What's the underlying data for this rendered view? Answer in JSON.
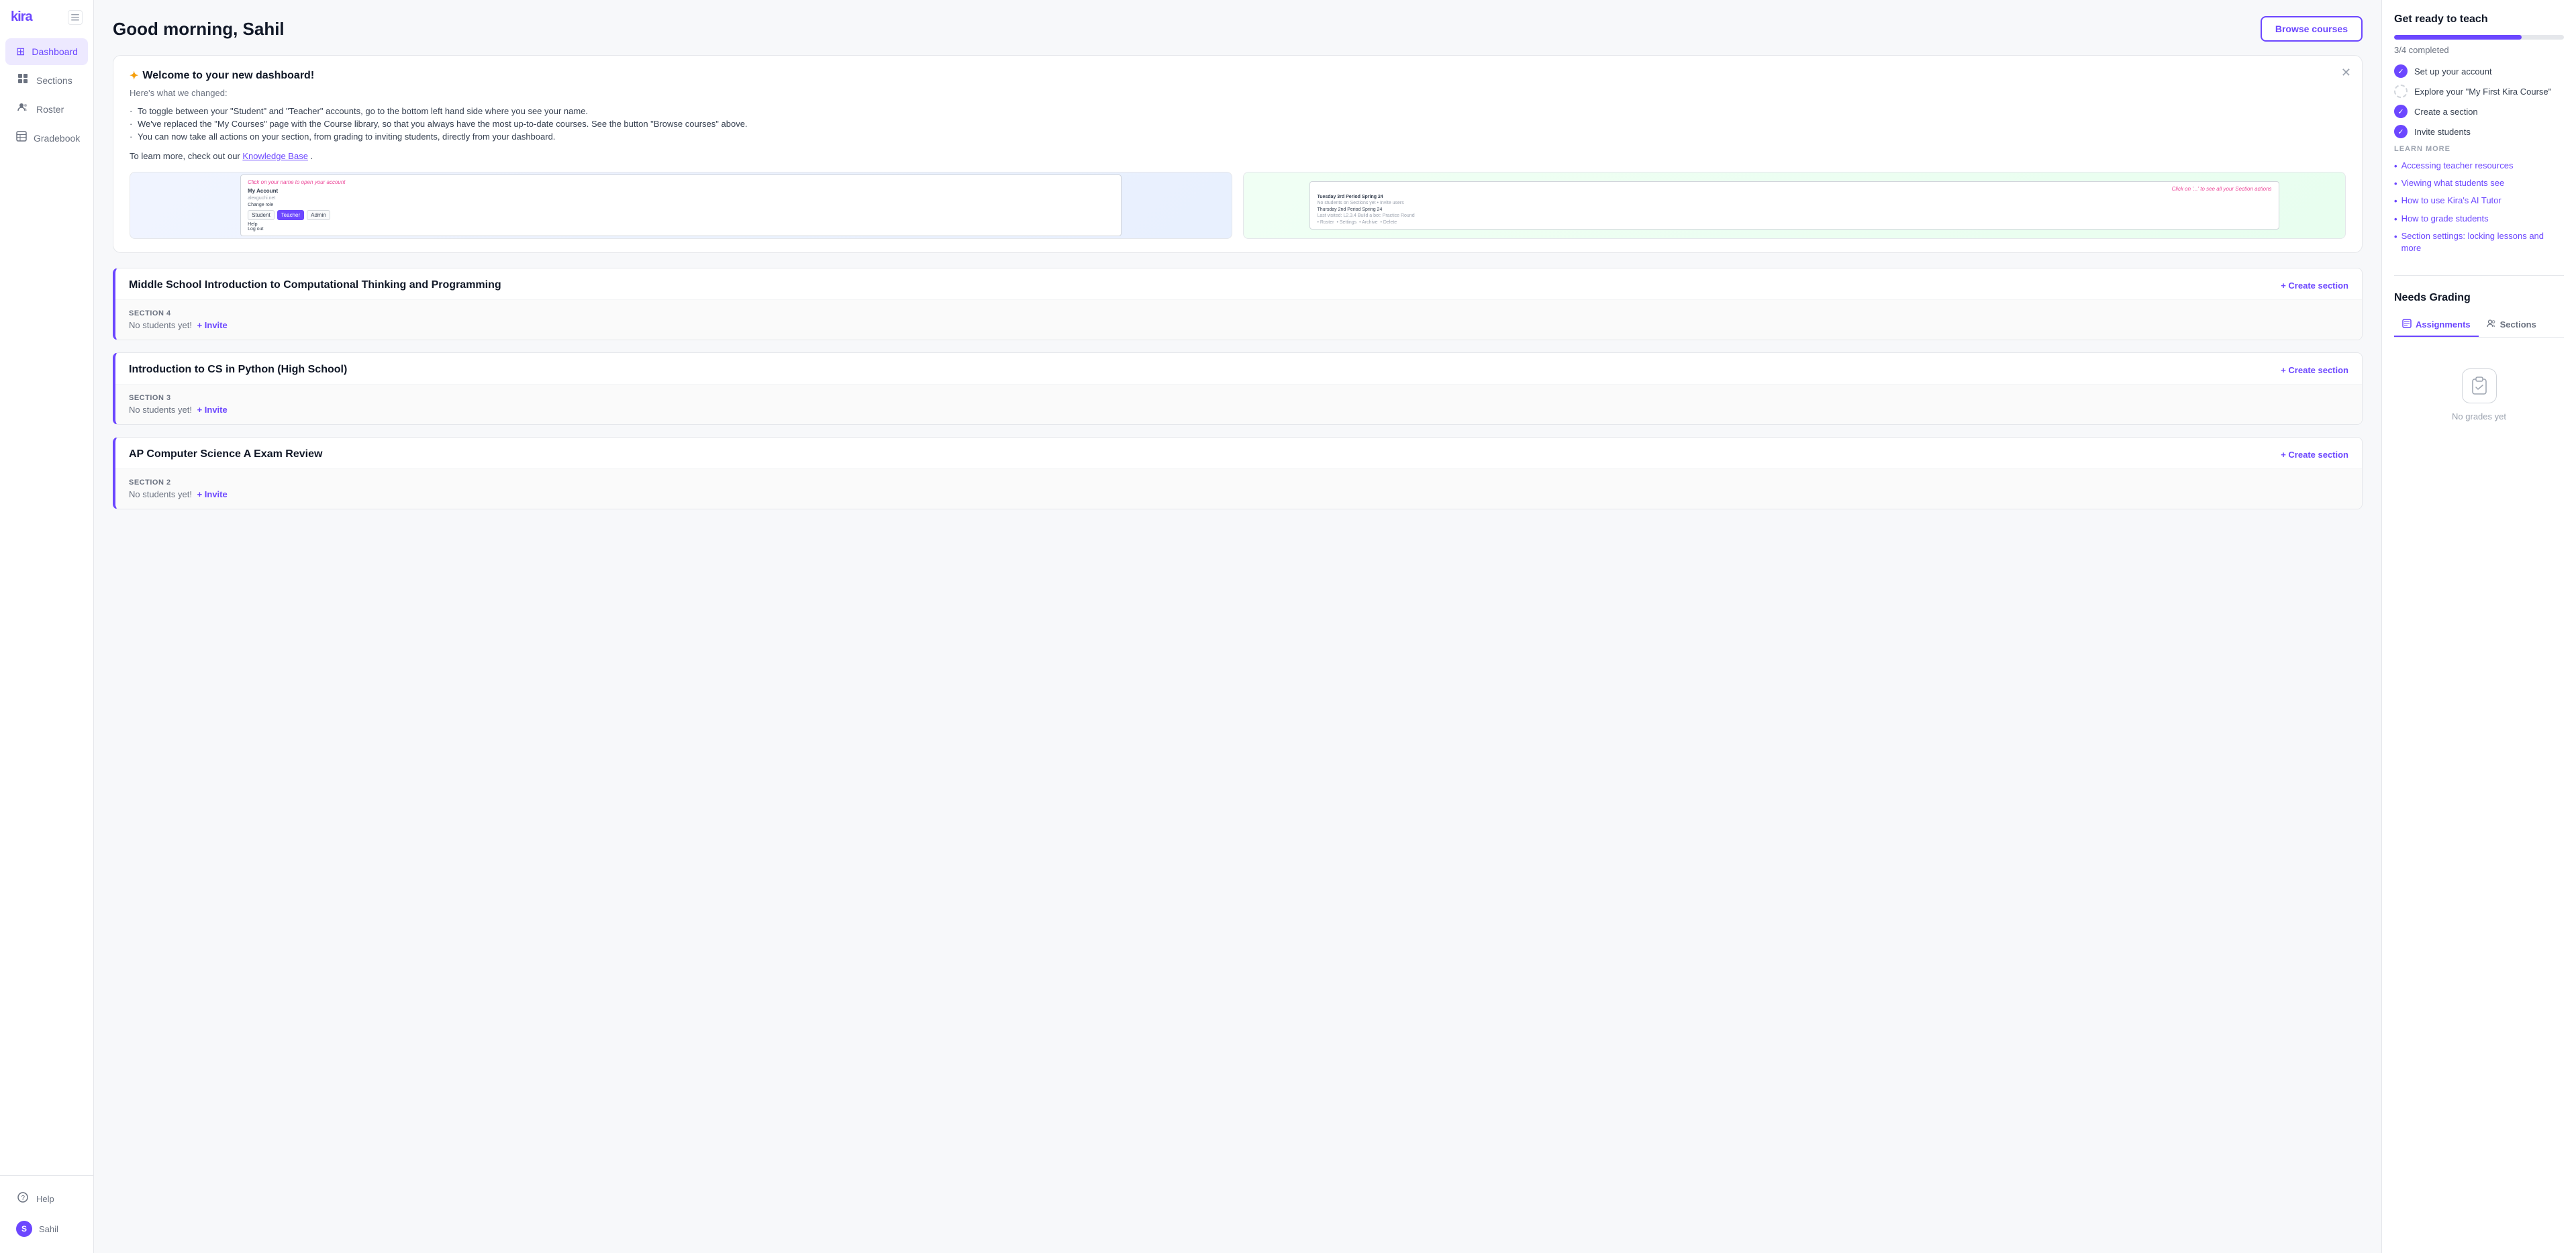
{
  "app": {
    "logo": "kira",
    "title": "Good morning, Sahil"
  },
  "sidebar": {
    "nav_items": [
      {
        "id": "dashboard",
        "label": "Dashboard",
        "icon": "⊞",
        "active": true
      },
      {
        "id": "sections",
        "label": "Sections",
        "icon": "⊟"
      },
      {
        "id": "roster",
        "label": "Roster",
        "icon": "👥"
      },
      {
        "id": "gradebook",
        "label": "Gradebook",
        "icon": "☰"
      }
    ],
    "bottom_items": [
      {
        "id": "help",
        "label": "Help",
        "icon": "?"
      },
      {
        "id": "user",
        "label": "Sahil",
        "avatar": "S"
      }
    ]
  },
  "header": {
    "title": "Good morning, Sahil",
    "browse_btn": "Browse courses"
  },
  "welcome_banner": {
    "title": "Welcome to your new dashboard!",
    "subtitle": "Here's what we changed:",
    "items": [
      "To toggle between your \"Student\" and \"Teacher\" accounts, go to the bottom left hand side where you see your name.",
      "We've replaced the \"My Courses\" page with the Course library, so that you always have the most up-to-date courses. See the button \"Browse courses\" above.",
      "You can now take all actions on your section, from grading to inviting students, directly from your dashboard."
    ],
    "footer_text": "To learn more, check out our ",
    "footer_link": "Knowledge Base",
    "footer_end": ".",
    "screenshot_left_highlight": "Click on your name to open your account",
    "screenshot_right_highlight": "Click on '...' to see all your Section actions",
    "screenshot_left_menu": [
      "My Account",
      "alexguchi.net",
      "Change role",
      "Help",
      "Log out"
    ],
    "screenshot_left_btns": [
      "Student",
      "Teacher",
      "Admin"
    ]
  },
  "courses": [
    {
      "id": "course1",
      "title": "Middle School Introduction to Computational Thinking and Programming",
      "sections": [
        {
          "label": "SECTION 4",
          "students": "No students yet!",
          "invite": "+ Invite"
        }
      ]
    },
    {
      "id": "course2",
      "title": "Introduction to CS in Python (High School)",
      "sections": [
        {
          "label": "SECTION 3",
          "students": "No students yet!",
          "invite": "+ Invite"
        }
      ]
    },
    {
      "id": "course3",
      "title": "AP Computer Science A Exam Review",
      "sections": [
        {
          "label": "SECTION 2",
          "students": "No students yet!",
          "invite": "+ Invite"
        }
      ]
    }
  ],
  "create_section_label": "+ Create section",
  "right_panel": {
    "get_ready": {
      "title": "Get ready to teach",
      "progress_pct": 75,
      "progress_label": "3/4 completed",
      "checklist": [
        {
          "label": "Set up your account",
          "done": true
        },
        {
          "label": "Explore your \"My First Kira Course\"",
          "done": false
        },
        {
          "label": "Create a section",
          "done": true
        },
        {
          "label": "Invite students",
          "done": true
        }
      ]
    },
    "learn_more": {
      "label": "LEARN MORE",
      "links": [
        "Accessing teacher resources",
        "Viewing what students see",
        "How to use Kira's AI Tutor",
        "How to grade students",
        "Section settings: locking lessons and more"
      ]
    },
    "needs_grading": {
      "title": "Needs Grading",
      "tabs": [
        {
          "label": "Assignments",
          "icon": "📋",
          "active": true
        },
        {
          "label": "Sections",
          "icon": "👥",
          "active": false
        }
      ],
      "empty_label": "No grades yet"
    }
  }
}
